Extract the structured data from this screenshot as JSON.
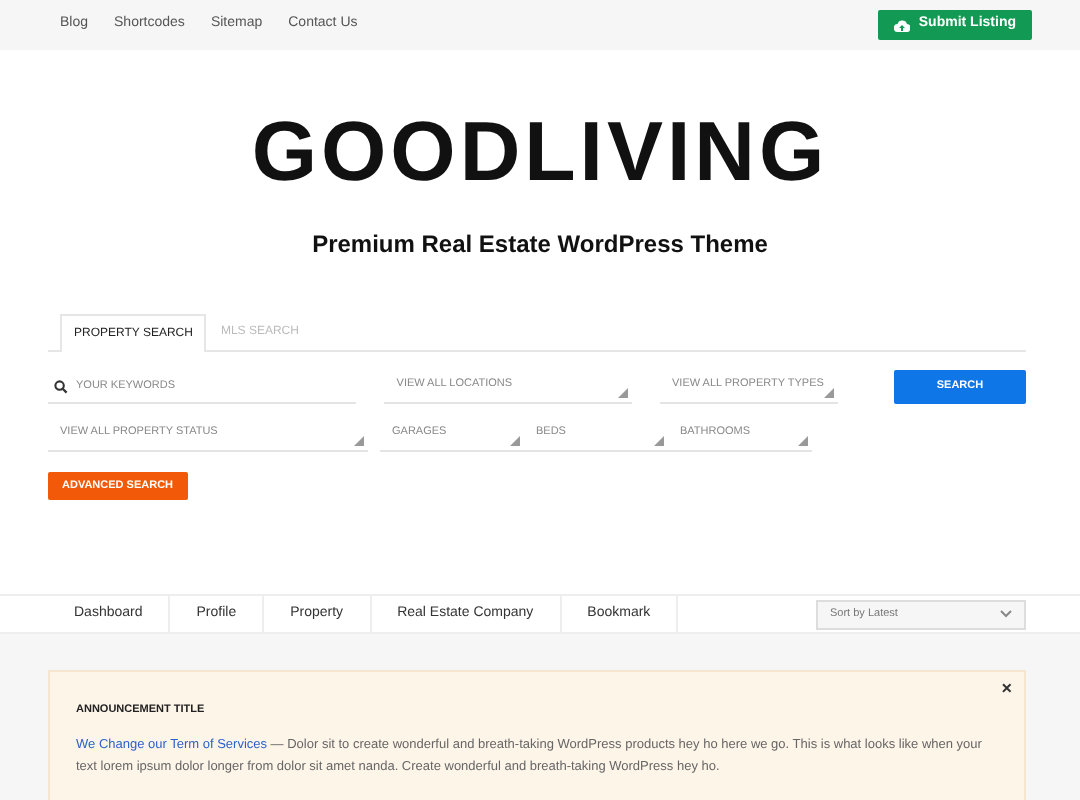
{
  "top_nav": {
    "links": [
      "Blog",
      "Shortcodes",
      "Sitemap",
      "Contact Us"
    ],
    "submit_button": "Submit Listing"
  },
  "logo": "GOODLIVING",
  "tagline": "Premium Real Estate WordPress Theme",
  "search": {
    "tabs": [
      {
        "label": "PROPERTY SEARCH",
        "selected": true
      },
      {
        "label": "MLS SEARCH",
        "selected": false
      }
    ],
    "keywords": {
      "placeholder": "YOUR KEYWORDS"
    },
    "row_1": [
      "VIEW ALL LOCATIONS",
      "VIEW ALL PROPERTY TYPES"
    ],
    "search_button": "SEARCH",
    "row_2": [
      "VIEW ALL PROPERTY STATUS",
      "GARAGES",
      "BEDS",
      "BATHROOMS"
    ],
    "advanced_button": "ADVANCED SEARCH"
  },
  "account_nav": {
    "items": [
      "Dashboard",
      "Profile",
      "Property",
      "Real Estate Company",
      "Bookmark"
    ],
    "sort": "Sort by Latest"
  },
  "announcement": {
    "title": "ANNOUNCEMENT TITLE",
    "close": "×",
    "link": "We Change our Term of Services",
    "text": " — Dolor sit to create wonderful and breath-taking WordPress products hey ho here we go. This is what looks like when your text lorem ipsum dolor longer from dolor sit amet nanda. Create wonderful and breath-taking WordPress hey ho."
  }
}
